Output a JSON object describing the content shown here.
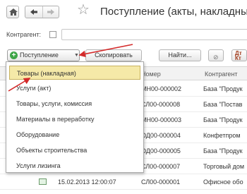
{
  "header": {
    "title": "Поступление (акты, накладные)"
  },
  "filter": {
    "label": "Контрагент:"
  },
  "toolbar": {
    "create_label": "Поступление",
    "copy_label": "Скопировать",
    "find_label": "Найти...",
    "icon2_text": "Дт\nКт"
  },
  "table": {
    "columns": [
      "Номер",
      "Контрагент"
    ],
    "rows": [
      {
        "number": "МН00-000002",
        "counterparty": "База \"Продук"
      },
      {
        "number": "СЛ00-000008",
        "counterparty": "База \"Постав"
      },
      {
        "number": "МН00-000003",
        "counterparty": "База \"Продук"
      },
      {
        "number": "ОД00-000004",
        "counterparty": "Конфетпром"
      },
      {
        "number": "ОД00-000005",
        "counterparty": "База \"Продук"
      },
      {
        "number": "СЛ00-000007",
        "counterparty": "Торговый дом"
      },
      {
        "date": "15.02.2013 12:00:07",
        "number": "СЛ00-000001",
        "counterparty": "Офисное обо"
      }
    ]
  },
  "dropdown": {
    "items": [
      "Товары (накладная)",
      "Услуги (акт)",
      "Товары, услуги, комиссия",
      "Материалы в переработку",
      "Оборудование",
      "Объекты строительства",
      "Услуги лизинга"
    ],
    "selected_index": 0
  },
  "colors": {
    "accent_arrow": "#d42a2a",
    "selection": "#f5e9a8",
    "create_icon": "#3fa648"
  }
}
